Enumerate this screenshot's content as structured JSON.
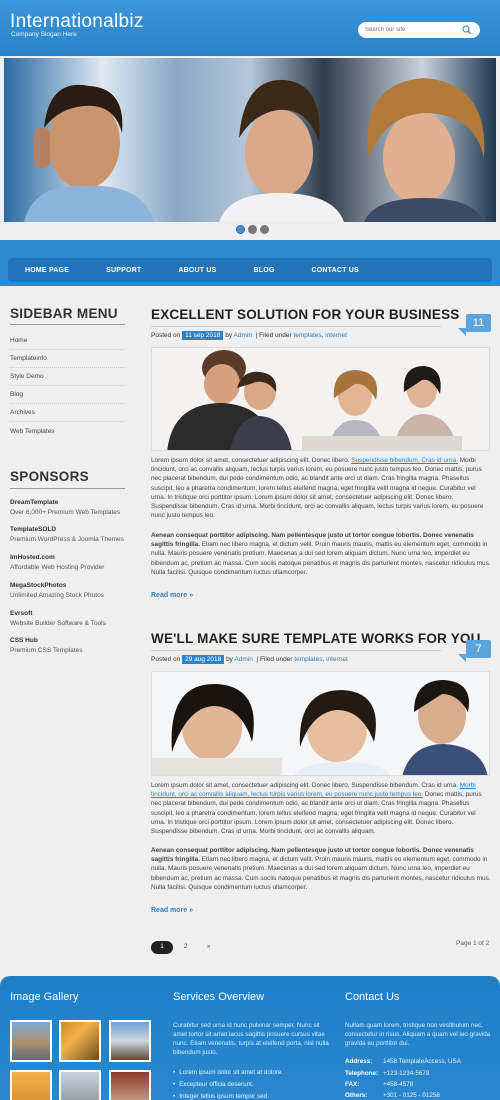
{
  "header": {
    "logo": "Internationalbiz",
    "slogan": "Company Slogan Here",
    "search_placeholder": "Search our site"
  },
  "slider": {
    "dots": 3,
    "active": 1
  },
  "nav": [
    "HOME PAGE",
    "SUPPORT",
    "ABOUT US",
    "BLOG",
    "CONTACT US"
  ],
  "sidebar": {
    "menu_title": "SIDEBAR MENU",
    "menu": [
      "Home",
      "Templateinfo",
      "Style Demo",
      "Blog",
      "Archives",
      "Web Templates"
    ],
    "sponsors_title": "SPONSORS",
    "sponsors": [
      {
        "name": "DreamTemplate",
        "desc": "Over 6,000+ Premium Web Templates"
      },
      {
        "name": "TemplateSOLD",
        "desc": "Premium WordPress & Joomla Themes"
      },
      {
        "name": "ImHosted.com",
        "desc": "Affordable Web Hosting Provider"
      },
      {
        "name": "MegaStockPhotos",
        "desc": "Unlimited Amazing Stock Photos"
      },
      {
        "name": "Evrsoft",
        "desc": "Website Builder Software & Tools"
      },
      {
        "name": "CSS Hub",
        "desc": "Premium CSS Templates"
      }
    ]
  },
  "posts": [
    {
      "title": "EXCELLENT SOLUTION FOR YOUR BUSINESS",
      "badge": "11",
      "posted_on": "Posted on",
      "date": "11 sep 2018",
      "by": "by",
      "author": "Admin",
      "filed": "|   Filed under",
      "tags": "templates",
      "tags2": "internet",
      "p1_a": "Lorem ipsum dolor sit amet, consectetuer adipiscing elit. Donec libero.",
      "p1_link": "Suspendisse bibendum. Cras id urna.",
      "p1_b": "Morbi tincidunt, orci ac convallis aliquam, lectus turpis varius lorem, eu posuere nunc justo tempus leo. Donec mattis, purus nec placerat bibendum, dui pede condimentum odio, ac blandit ante orci ut diam. Cras fringilla magna. Phasellus suscipit, leo a pharetra condimentum, lorem tellus eleifend magna, eget fringilla velit magna id neque. Curabitur vel urna. In tristique orci porttitor ipsum. Lorem ipsum dolor sit amet, consectetuer adipiscing elit. Donec libero. Suspendisse bibendum. Cras id urna. Morbi tincidunt, orci ac convallis aliquam, lectus turpis varius lorem, eu posuere nunc justo tempus leo.",
      "p2_bold": "Aenean consequat porttitor adipiscing. Nam pellentesque justo ut tortor congue lobortis. Donec venenatis sagittis fringilla.",
      "p2": "Etiam nec libero magna, et dictum velit. Proin mauris mauris, mattis eu elementum eget, commodo in nulla. Mauris posuere venenatis pretium. Maecenas a dui sed lorem aliquam dictum. Nunc urna leo, imperdiet eu bibendum ac, pretium ac massa. Cum sociis natoque penatibus et magnis dis parturient montes, nascetur ridiculus mus. Nulla facilisi. Quisque condimentum luctus ullamcorper.",
      "readmore": "Read more »"
    },
    {
      "title": "WE'LL MAKE SURE TEMPLATE WORKS FOR YOU",
      "badge": "7",
      "posted_on": "Posted on",
      "date": "29 aug 2018",
      "by": "by",
      "author": "Admin",
      "filed": "|   Filed under",
      "tags": "templates",
      "tags2": "internet",
      "p1_a": "Lorem ipsum dolor sit amet, consectetuer adipiscing elit. Donec libero. Suspendisse bibendum. Cras id urna.",
      "p1_link": "Morbi tincidunt, orci ac convallis aliquam, lectus turpis varius lorem, eu posuere nunc justo tempus leo.",
      "p1_b": "Donec mattis, purus nec placerat bibendum, dui pede condimentum odio, ac blandit ante orci ut diam. Cras fringilla magna. Phasellus suscipit, leo a pharetra condimentum, lorem tellus eleifend magna, eget fringilla velit magna id neque. Curabitur vel urna. In tristique orci porttitor ipsum. Lorem ipsum dolor sit amet, consectetuer adipiscing elit. Donec libero. Suspendisse bibendum. Cras id urna. Morbi tincidunt, orci ac convallis aliquam.",
      "p2_bold": "Aenean consequat porttitor adipiscing. Nam pellentesque justo ut tortor congue lobortis. Donec venenatis sagittis fringilla.",
      "p2": "Etiam nec libero magna, et dictum velit. Proin mauris mauris, mattis eu elementum eget, commodo in nulla. Mauris posuere venenatis pretium. Maecenas a dui sed lorem aliquam dictum. Nunc urna leo, imperdiet eu bibendum ac, pretium ac massa. Cum sociis natoque penatibus et magnis dis parturient montes, nascetur ridiculus mus. Nulla facilisi. Quisque condimentum luctus ullamcorper.",
      "readmore": "Read more »"
    }
  ],
  "pagination": {
    "current": "1",
    "next": "2",
    "arrow": "»",
    "page_of": "Page 1 of 2"
  },
  "footer": {
    "gallery_title": "Image Gallery",
    "services_title": "Services Overview",
    "services_text": "Curabitur sed urna id nunc pulvinar semper. Nunc sit amet tortor sit amet lacus sagittis posuere cursus vitae nunc. Etiam venenatis, turpis at eleifend porta, nisl nulla bibendum justo.",
    "services_list": [
      "Lorem ipsum dolor sit amet at dolore.",
      "Excepteur officia deserunt.",
      "Integer tellus ipsum tempor sed."
    ],
    "contact_title": "Contact Us",
    "contact_text": "Nullam quam lorem, tristique non vestibulum nec, consectetur in risus. Aliquam a quam vel leo gravida gravida eu porttitor dui.",
    "contact": [
      {
        "k": "Address:",
        "v": "1458 TemplateAccess, USA"
      },
      {
        "k": "Telephone:",
        "v": "+123-1234-5678"
      },
      {
        "k": "FAX:",
        "v": "+458-4578"
      },
      {
        "k": "Others:",
        "v": "+301 - 0125 - 01258"
      }
    ]
  },
  "colors": {
    "brand_blue": "#2a82c8",
    "nav_blue": "#2273b8",
    "badge": "#5aa5de"
  }
}
